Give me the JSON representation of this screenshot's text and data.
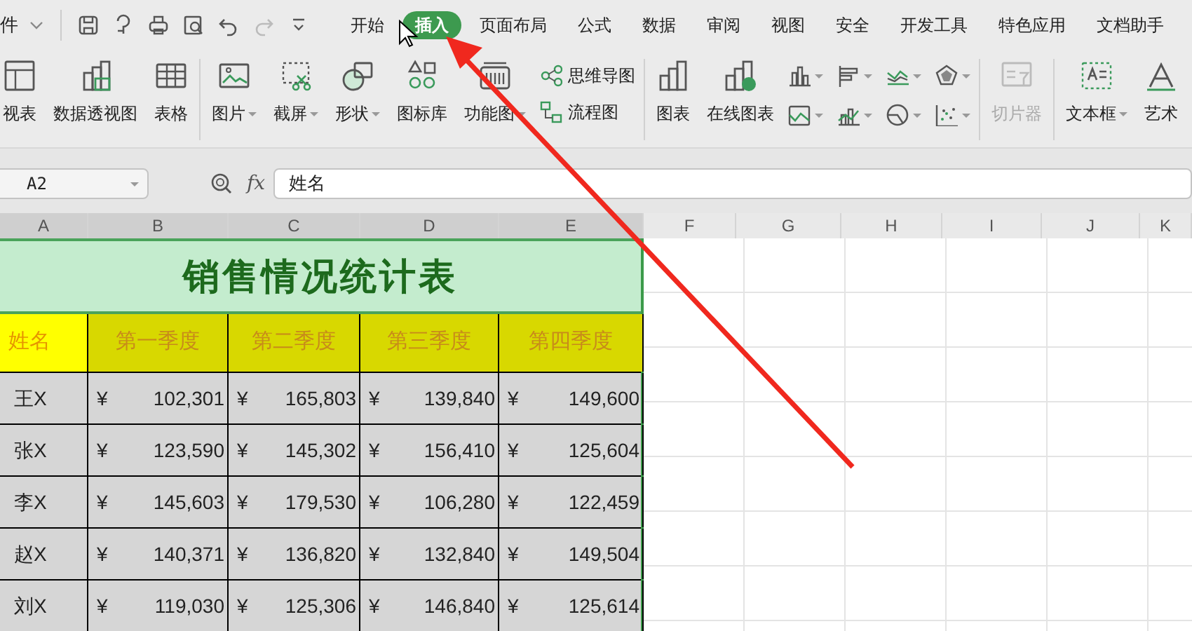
{
  "file_menu": {
    "label": "件"
  },
  "tabs": [
    {
      "label": "开始",
      "selected": false
    },
    {
      "label": "插入",
      "selected": true
    },
    {
      "label": "页面布局",
      "selected": false
    },
    {
      "label": "公式",
      "selected": false
    },
    {
      "label": "数据",
      "selected": false
    },
    {
      "label": "审阅",
      "selected": false
    },
    {
      "label": "视图",
      "selected": false
    },
    {
      "label": "安全",
      "selected": false
    },
    {
      "label": "开发工具",
      "selected": false
    },
    {
      "label": "特色应用",
      "selected": false
    },
    {
      "label": "文档助手",
      "selected": false
    }
  ],
  "ribbon": {
    "groups": [
      [
        {
          "kind": "large",
          "label": "视表",
          "dropdown": false,
          "disabled": false
        },
        {
          "kind": "large",
          "label": "数据透视图",
          "dropdown": false,
          "disabled": false
        },
        {
          "kind": "large",
          "label": "表格",
          "dropdown": false,
          "disabled": false
        }
      ],
      [
        {
          "kind": "large",
          "label": "图片",
          "dropdown": true,
          "disabled": false
        },
        {
          "kind": "large",
          "label": "截屏",
          "dropdown": true,
          "disabled": false
        },
        {
          "kind": "large",
          "label": "形状",
          "dropdown": true,
          "disabled": false
        },
        {
          "kind": "large",
          "label": "图标库",
          "dropdown": false,
          "disabled": false
        },
        {
          "kind": "large",
          "label": "功能图",
          "dropdown": true,
          "disabled": false
        },
        {
          "kind": "small",
          "items": [
            {
              "label": "思维导图"
            },
            {
              "label": "流程图"
            }
          ]
        }
      ],
      [
        {
          "kind": "large",
          "label": "图表",
          "dropdown": false,
          "disabled": false
        },
        {
          "kind": "large",
          "label": "在线图表",
          "dropdown": false,
          "disabled": false
        },
        {
          "kind": "icons"
        }
      ],
      [
        {
          "kind": "large",
          "label": "切片器",
          "dropdown": false,
          "disabled": true
        }
      ],
      [
        {
          "kind": "large",
          "label": "文本框",
          "dropdown": true,
          "disabled": false
        },
        {
          "kind": "large",
          "label": "艺术",
          "dropdown": false,
          "disabled": false
        }
      ]
    ]
  },
  "formula_bar": {
    "cell_ref": "A2",
    "fx": "fx",
    "value": "姓名"
  },
  "columns": [
    {
      "label": "A",
      "highlighted": true
    },
    {
      "label": "B",
      "highlighted": true
    },
    {
      "label": "C",
      "highlighted": true
    },
    {
      "label": "D",
      "highlighted": true
    },
    {
      "label": "E",
      "highlighted": true
    },
    {
      "label": "F",
      "highlighted": false
    },
    {
      "label": "G",
      "highlighted": false
    },
    {
      "label": "H",
      "highlighted": false
    },
    {
      "label": "I",
      "highlighted": false
    },
    {
      "label": "J",
      "highlighted": false
    },
    {
      "label": "K",
      "highlighted": false
    }
  ],
  "sheet": {
    "title": "销售情况统计表",
    "headers": [
      "姓名",
      "第一季度",
      "第二季度",
      "第三季度",
      "第四季度"
    ],
    "rows": [
      {
        "name": "王X",
        "cells": [
          {
            "currency": "¥",
            "amount": "102,301"
          },
          {
            "currency": "¥",
            "amount": "165,803"
          },
          {
            "currency": "¥",
            "amount": "139,840"
          },
          {
            "currency": "¥",
            "amount": "149,600"
          }
        ]
      },
      {
        "name": "张X",
        "cells": [
          {
            "currency": "¥",
            "amount": "123,590"
          },
          {
            "currency": "¥",
            "amount": "145,302"
          },
          {
            "currency": "¥",
            "amount": "156,410"
          },
          {
            "currency": "¥",
            "amount": "125,604"
          }
        ]
      },
      {
        "name": "李X",
        "cells": [
          {
            "currency": "¥",
            "amount": "145,603"
          },
          {
            "currency": "¥",
            "amount": "179,530"
          },
          {
            "currency": "¥",
            "amount": "106,280"
          },
          {
            "currency": "¥",
            "amount": "122,459"
          }
        ]
      },
      {
        "name": "赵X",
        "cells": [
          {
            "currency": "¥",
            "amount": "140,371"
          },
          {
            "currency": "¥",
            "amount": "136,820"
          },
          {
            "currency": "¥",
            "amount": "132,840"
          },
          {
            "currency": "¥",
            "amount": "149,504"
          }
        ]
      },
      {
        "name": "刘X",
        "cells": [
          {
            "currency": "¥",
            "amount": "119,030"
          },
          {
            "currency": "¥",
            "amount": "125,306"
          },
          {
            "currency": "¥",
            "amount": "146,840"
          },
          {
            "currency": "¥",
            "amount": "125,614"
          }
        ]
      }
    ]
  }
}
